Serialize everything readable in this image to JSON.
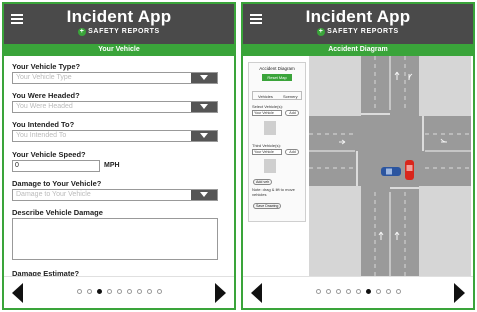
{
  "app": {
    "title": "Incident App",
    "subtitle": "SAFETY REPORTS",
    "plus_symbol": "+"
  },
  "left_screen": {
    "section_title": "Your Vehicle",
    "fields": [
      {
        "label": "Your Vehicle Type?",
        "placeholder": "Your Vehicle Type"
      },
      {
        "label": "You Were Headed?",
        "placeholder": "You Were Headed"
      },
      {
        "label": "You Intended To?",
        "placeholder": "You Intended To"
      }
    ],
    "speed": {
      "label": "Your Vehicle Speed?",
      "value": "0",
      "unit": "MPH"
    },
    "damage": {
      "label": "Damage to Your Vehicle?",
      "placeholder": "Damage to Your Vehicle"
    },
    "describe_label": "Describe Vehicle Damage",
    "estimate_label": "Damage Estimate?",
    "pagination": {
      "total": 9,
      "active_index": 2
    }
  },
  "right_screen": {
    "section_title": "Accident Diagram",
    "panel": {
      "title": "Accident Diagram",
      "button": "Reset Map",
      "tabs": [
        "Vehicles",
        "Scenery"
      ],
      "select_label": "Select Vehicle(s):",
      "select_value": "Your Vehicle",
      "add_label": "Add",
      "third_label": "Third Vehicle(s):",
      "third_value": "Your Vehicle",
      "third_add": "Add",
      "add_veh_button": "Add veh",
      "note": "Note: drag & lift to move vehicles",
      "save_button": "Save Drawing"
    },
    "pagination": {
      "total": 9,
      "active_index": 5
    }
  },
  "icons": {
    "menu": "hamburger-icon",
    "prev": "triangle-left-icon",
    "next": "triangle-right-icon",
    "dropdown": "chevron-down-icon"
  },
  "colors": {
    "header": "#4a4a4a",
    "accent_green": "#3aa43a",
    "road": "#9a9a9a",
    "grass": "#d6d6d6",
    "red_vehicle": "#d9261c",
    "blue_vehicle": "#2b55a0"
  }
}
